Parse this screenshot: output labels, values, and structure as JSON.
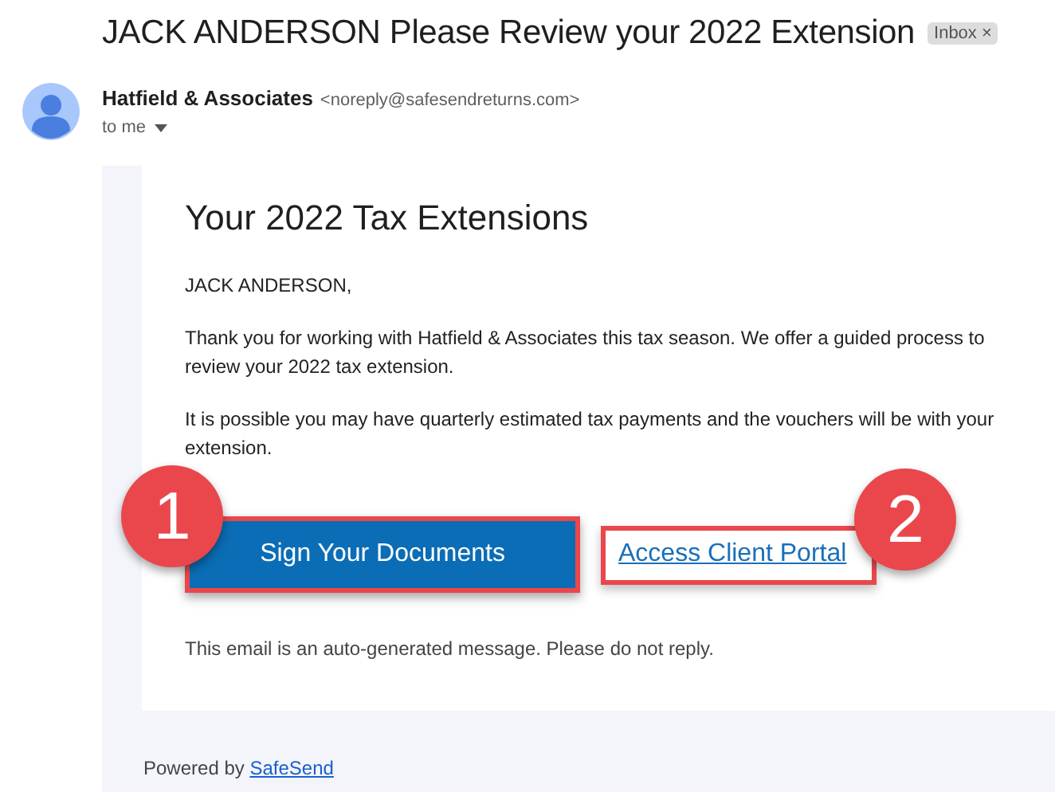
{
  "subject": "JACK ANDERSON Please Review your 2022 Extension",
  "label": {
    "text": "Inbox",
    "remove": "×"
  },
  "sender": {
    "name": "Hatfield & Associates",
    "address": "<noreply@safesendreturns.com>",
    "recipient": "to me"
  },
  "email": {
    "heading": "Your 2022 Tax Extensions",
    "greeting": "JACK ANDERSON,",
    "paragraphs": [
      "Thank you for working with Hatfield & Associates this tax season. We offer a guided process to review your 2022 tax extension.",
      "It is possible you may have quarterly estimated tax payments and the vouchers will be with your extension."
    ],
    "primary_button": {
      "label": "Sign Your Documents",
      "step": "1"
    },
    "link": {
      "label": "Access Client Portal",
      "step": "2"
    },
    "notice": "This email is an auto-generated message. Please do not reply.",
    "footer": {
      "text": "Powered by",
      "link": "SafeSend"
    }
  }
}
